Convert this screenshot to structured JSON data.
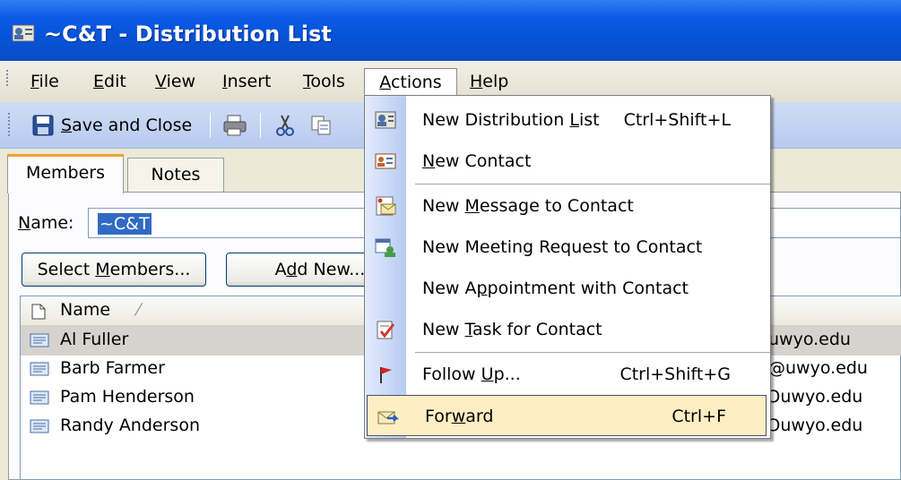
{
  "window": {
    "title": "~C&T - Distribution List"
  },
  "menubar": {
    "items": [
      {
        "label": "File",
        "mnemonic": "F",
        "rest": "ile"
      },
      {
        "label": "Edit",
        "mnemonic": "E",
        "rest": "dit"
      },
      {
        "label": "View",
        "mnemonic": "V",
        "rest": "iew"
      },
      {
        "label": "Insert",
        "mnemonic": "I",
        "rest": "nsert"
      },
      {
        "label": "Tools",
        "mnemonic": "T",
        "rest": "ools"
      },
      {
        "label": "Actions",
        "mnemonic": "A",
        "rest": "ctions"
      },
      {
        "label": "Help",
        "mnemonic": "H",
        "rest": "elp"
      }
    ]
  },
  "toolbar": {
    "save_close_label": "Save and Close",
    "save_mnemonic": "S",
    "save_rest": "ave and Close"
  },
  "tabs": [
    {
      "label": "Members"
    },
    {
      "label": "Notes"
    }
  ],
  "form": {
    "name_label": "Name:",
    "name_value": "~C&T",
    "select_members_label": "Select Members...",
    "add_new_label": "Add New..."
  },
  "list": {
    "column_name": "Name",
    "sort_indicator": "⁄",
    "rows": [
      {
        "name": "Al Fuller",
        "email": "uwyo.edu"
      },
      {
        "name": "Barb Farmer",
        "email": "@uwyo.edu"
      },
      {
        "name": "Pam Henderson",
        "email": "Ͻuwyo.edu"
      },
      {
        "name": "Randy Anderson",
        "email": "Ͻuwyo.edu"
      }
    ]
  },
  "actions_menu": {
    "items": [
      {
        "pre": "New Distribution ",
        "mn": "L",
        "post": "ist",
        "shortcut": "Ctrl+Shift+L",
        "icon": "distribution-list-icon"
      },
      {
        "pre": "",
        "mn": "N",
        "post": "ew Contact",
        "shortcut": "",
        "icon": "contact-card-icon"
      },
      {
        "pre": "New ",
        "mn": "M",
        "post": "essage to Contact",
        "shortcut": "",
        "icon": "message-icon"
      },
      {
        "pre": "New Meetin",
        "mn": "g",
        "post": " Request to Contact",
        "shortcut": "",
        "icon": "meeting-request-icon"
      },
      {
        "pre": "New A",
        "mn": "p",
        "post": "pointment with Contact",
        "shortcut": "",
        "icon": ""
      },
      {
        "pre": "New ",
        "mn": "T",
        "post": "ask for Contact",
        "shortcut": "",
        "icon": "task-icon"
      },
      {
        "pre": "Follow ",
        "mn": "U",
        "post": "p...",
        "shortcut": "Ctrl+Shift+G",
        "icon": "follow-up-flag-icon"
      },
      {
        "pre": "For",
        "mn": "w",
        "post": "ard",
        "shortcut": "Ctrl+F",
        "icon": "forward-icon"
      }
    ]
  },
  "colors": {
    "title_bar": "#0753d8",
    "menu_highlight": "#ffeec2",
    "selection": "#316ac5"
  }
}
